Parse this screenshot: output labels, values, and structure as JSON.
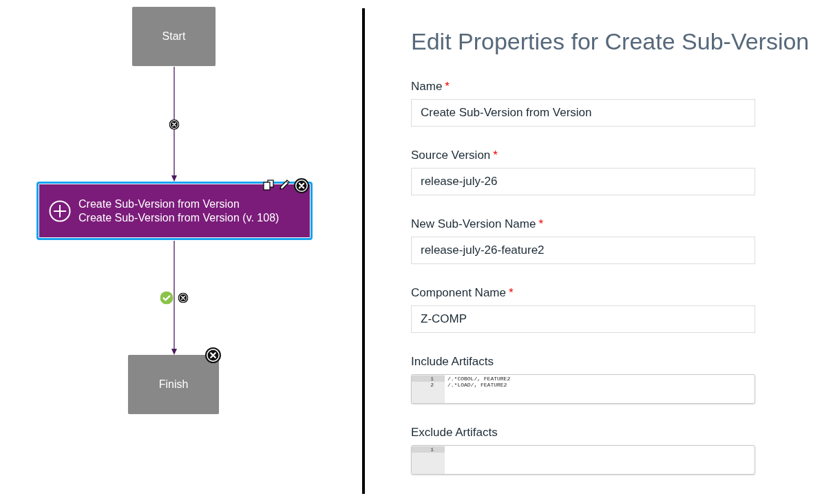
{
  "diagram": {
    "nodes": [
      {
        "kind": "terminal",
        "label": "Start",
        "selected": false,
        "deletable": false
      },
      {
        "kind": "action",
        "title": "Create Sub-Version from Version",
        "subtitle": "Create Sub-Version from Version (v. 108)",
        "selected": true,
        "deletable": true
      },
      {
        "kind": "terminal",
        "label": "Finish",
        "selected": false,
        "deletable": true
      }
    ],
    "connectors": [
      {
        "markers": [
          {
            "kind": "delete"
          }
        ]
      },
      {
        "markers": [
          {
            "kind": "success"
          },
          {
            "kind": "delete"
          }
        ]
      }
    ]
  },
  "properties": {
    "title": "Edit Properties for Create Sub-Version",
    "required_mark": "*",
    "fields": [
      {
        "kind": "text",
        "label": "Name",
        "required": true,
        "value": "Create Sub-Version from Version"
      },
      {
        "kind": "text",
        "label": "Source Version",
        "required": true,
        "value": "release-july-26"
      },
      {
        "kind": "text",
        "label": "New Sub-Version Name",
        "required": true,
        "value": "release-july-26-feature2"
      },
      {
        "kind": "text",
        "label": "Component Name",
        "required": true,
        "value": "Z-COMP"
      },
      {
        "kind": "code",
        "label": "Include Artifacts",
        "required": false,
        "lines": [
          {
            "number": "1",
            "text": "/.*COBOL/, FEATURE2",
            "active": true
          },
          {
            "number": "2",
            "text": "/.*LOAD/, FEATURE2",
            "active": false
          }
        ]
      },
      {
        "kind": "code",
        "label": "Exclude Artifacts",
        "required": false,
        "lines": [
          {
            "number": "1",
            "active": true
          }
        ]
      }
    ]
  }
}
